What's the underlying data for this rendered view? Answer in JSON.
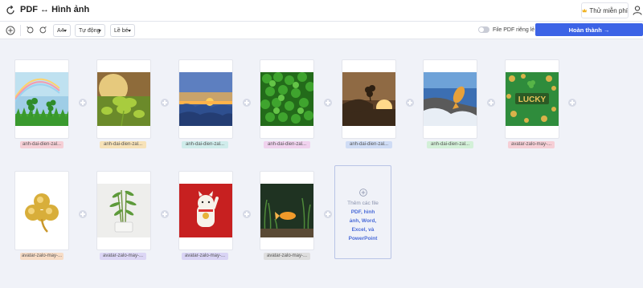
{
  "header": {
    "title": "PDF ↔ Hình ảnh",
    "premium_label": "Thử miễn phí"
  },
  "toolbar": {
    "page_size": "A4",
    "orientation": "Tự động",
    "margin": "Lề bé",
    "separate_pdf_label": "File PDF riêng lẻ",
    "separate_pdf_on": false,
    "finish_label": "Hoàn thành →"
  },
  "files": [
    {
      "name": "anh-dai-dien-zal...",
      "label_color": "#f6cfd6",
      "image": "rainbow-clover"
    },
    {
      "name": "anh-dai-dien-zal...",
      "label_color": "#f7e2b8",
      "image": "sunlit-clover"
    },
    {
      "name": "anh-dai-dien-zal...",
      "label_color": "#cfeceb",
      "image": "sunset-clouds"
    },
    {
      "name": "anh-dai-dien-zal...",
      "label_color": "#f0d2ee",
      "image": "clover-field"
    },
    {
      "name": "anh-dai-dien-zal...",
      "label_color": "#cfdcf5",
      "image": "hand-clover-sunset"
    },
    {
      "name": "anh-dai-dien-zal...",
      "label_color": "#d3f0d8",
      "image": "koi-fish-wave"
    },
    {
      "name": "avatar-zalo-may-...",
      "label_color": "#f6cfd6",
      "image": "lucky-coins"
    },
    {
      "name": "avatar-zalo-may-...",
      "label_color": "#f7dcc6",
      "image": "gold-clover"
    },
    {
      "name": "avatar-zalo-may-...",
      "label_color": "#dcd6f5",
      "image": "lucky-bamboo"
    },
    {
      "name": "avatar-zalo-may-...",
      "label_color": "#d9d4f5",
      "image": "lucky-cat"
    },
    {
      "name": "avatar-zalo-may-...",
      "label_color": "#dedede",
      "image": "goldfish-tank"
    }
  ],
  "add_card": {
    "line1": "Thêm các file",
    "line2": "PDF, hình",
    "line3": "ảnh, Word,",
    "line4": "Excel, và",
    "line5": "PowerPoint"
  },
  "colors": {
    "accent": "#3c63e6",
    "background": "#f0f2f8"
  }
}
